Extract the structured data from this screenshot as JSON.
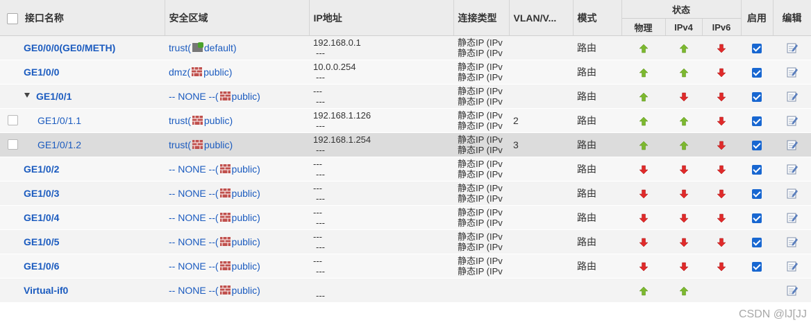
{
  "header": {
    "name": "接口名称",
    "zone": "安全区域",
    "ip": "IP地址",
    "conn": "连接类型",
    "vlan": "VLAN/V...",
    "mode": "模式",
    "state": "状态",
    "physical": "物理",
    "ipv4": "IPv4",
    "ipv6": "IPv6",
    "enable": "启用",
    "edit": "编辑"
  },
  "colors": {
    "up": "#7cb82f",
    "down": "#e02a2a",
    "link": "#1b5bbf"
  },
  "rows": [
    {
      "name": "GE0/0/0(GE0/METH)",
      "zone_pre": "trust(",
      "zone_post": "default)",
      "zone_icon": "green-firewall-icon",
      "ip1": "192.168.0.1",
      "ip2": "---",
      "conn1": "静态IP (IPv",
      "conn2": "静态IP (IPv",
      "vlan": "",
      "mode": "路由",
      "phy": "up",
      "v4": "up",
      "v6": "down",
      "enabled": true,
      "level": "top",
      "check": false
    },
    {
      "name": "GE1/0/0",
      "zone_pre": "dmz(",
      "zone_post": "public)",
      "zone_icon": "firewall-icon",
      "ip1": "10.0.0.254",
      "ip2": "---",
      "conn1": "静态IP (IPv",
      "conn2": "静态IP (IPv",
      "vlan": "",
      "mode": "路由",
      "phy": "up",
      "v4": "up",
      "v6": "down",
      "enabled": true,
      "level": "top",
      "check": false
    },
    {
      "name": "GE1/0/1",
      "zone_pre": "-- NONE --(",
      "zone_post": "public)",
      "zone_icon": "firewall-icon",
      "ip1": "---",
      "ip2": "---",
      "conn1": "静态IP (IPv",
      "conn2": "静态IP (IPv",
      "vlan": "",
      "mode": "路由",
      "phy": "up",
      "v4": "down",
      "v6": "down",
      "enabled": true,
      "level": "parent",
      "check": false
    },
    {
      "name": "GE1/0/1.1",
      "zone_pre": "trust(",
      "zone_post": "public)",
      "zone_icon": "firewall-icon",
      "ip1": "192.168.1.126",
      "ip2": "---",
      "conn1": "静态IP (IPv",
      "conn2": "静态IP (IPv",
      "vlan": "2",
      "mode": "路由",
      "phy": "up",
      "v4": "up",
      "v6": "down",
      "enabled": true,
      "level": "sub",
      "check": true
    },
    {
      "name": "GE1/0/1.2",
      "zone_pre": "trust(",
      "zone_post": "public)",
      "zone_icon": "firewall-icon",
      "ip1": "192.168.1.254",
      "ip2": "---",
      "conn1": "静态IP (IPv",
      "conn2": "静态IP (IPv",
      "vlan": "3",
      "mode": "路由",
      "phy": "up",
      "v4": "up",
      "v6": "down",
      "enabled": true,
      "level": "sub",
      "check": true,
      "selected": true
    },
    {
      "name": "GE1/0/2",
      "zone_pre": "-- NONE --(",
      "zone_post": "public)",
      "zone_icon": "firewall-icon",
      "ip1": "---",
      "ip2": "---",
      "conn1": "静态IP (IPv",
      "conn2": "静态IP (IPv",
      "vlan": "",
      "mode": "路由",
      "phy": "down",
      "v4": "down",
      "v6": "down",
      "enabled": true,
      "level": "top",
      "check": false
    },
    {
      "name": "GE1/0/3",
      "zone_pre": "-- NONE --(",
      "zone_post": "public)",
      "zone_icon": "firewall-icon",
      "ip1": "---",
      "ip2": "---",
      "conn1": "静态IP (IPv",
      "conn2": "静态IP (IPv",
      "vlan": "",
      "mode": "路由",
      "phy": "down",
      "v4": "down",
      "v6": "down",
      "enabled": true,
      "level": "top",
      "check": false
    },
    {
      "name": "GE1/0/4",
      "zone_pre": "-- NONE --(",
      "zone_post": "public)",
      "zone_icon": "firewall-icon",
      "ip1": "---",
      "ip2": "---",
      "conn1": "静态IP (IPv",
      "conn2": "静态IP (IPv",
      "vlan": "",
      "mode": "路由",
      "phy": "down",
      "v4": "down",
      "v6": "down",
      "enabled": true,
      "level": "top",
      "check": false
    },
    {
      "name": "GE1/0/5",
      "zone_pre": "-- NONE --(",
      "zone_post": "public)",
      "zone_icon": "firewall-icon",
      "ip1": "---",
      "ip2": "---",
      "conn1": "静态IP (IPv",
      "conn2": "静态IP (IPv",
      "vlan": "",
      "mode": "路由",
      "phy": "down",
      "v4": "down",
      "v6": "down",
      "enabled": true,
      "level": "top",
      "check": false
    },
    {
      "name": "GE1/0/6",
      "zone_pre": "-- NONE --(",
      "zone_post": "public)",
      "zone_icon": "firewall-icon",
      "ip1": "---",
      "ip2": "---",
      "conn1": "静态IP (IPv",
      "conn2": "静态IP (IPv",
      "vlan": "",
      "mode": "路由",
      "phy": "down",
      "v4": "down",
      "v6": "down",
      "enabled": true,
      "level": "top",
      "check": false
    },
    {
      "name": "Virtual-if0",
      "zone_pre": "-- NONE --(",
      "zone_post": "public)",
      "zone_icon": "firewall-icon",
      "ip1": "",
      "ip2": "---",
      "conn1": "",
      "conn2": "",
      "vlan": "",
      "mode": "",
      "phy": "up",
      "v4": "up",
      "v6": "",
      "enabled": false,
      "level": "top",
      "check": false
    }
  ],
  "watermark": "CSDN @lJ[JJ"
}
